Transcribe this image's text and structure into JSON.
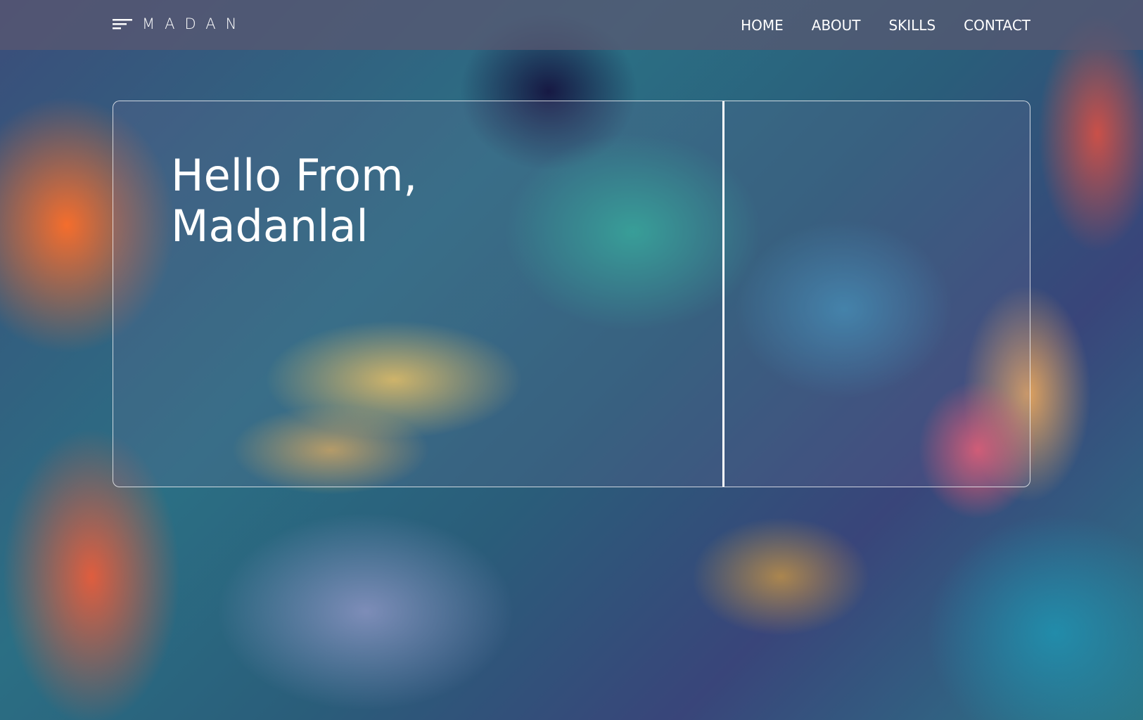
{
  "header": {
    "logo": "MADAN",
    "menu_icon": "hamburger-menu-icon",
    "nav": [
      {
        "label": "HOME"
      },
      {
        "label": "ABOUT"
      },
      {
        "label": "SKILLS"
      },
      {
        "label": "CONTACT"
      }
    ]
  },
  "hero": {
    "line1": "Hello From,",
    "line2": "Madanlal"
  },
  "colors": {
    "text": "#ffffff",
    "navbar": "#5a5870"
  }
}
